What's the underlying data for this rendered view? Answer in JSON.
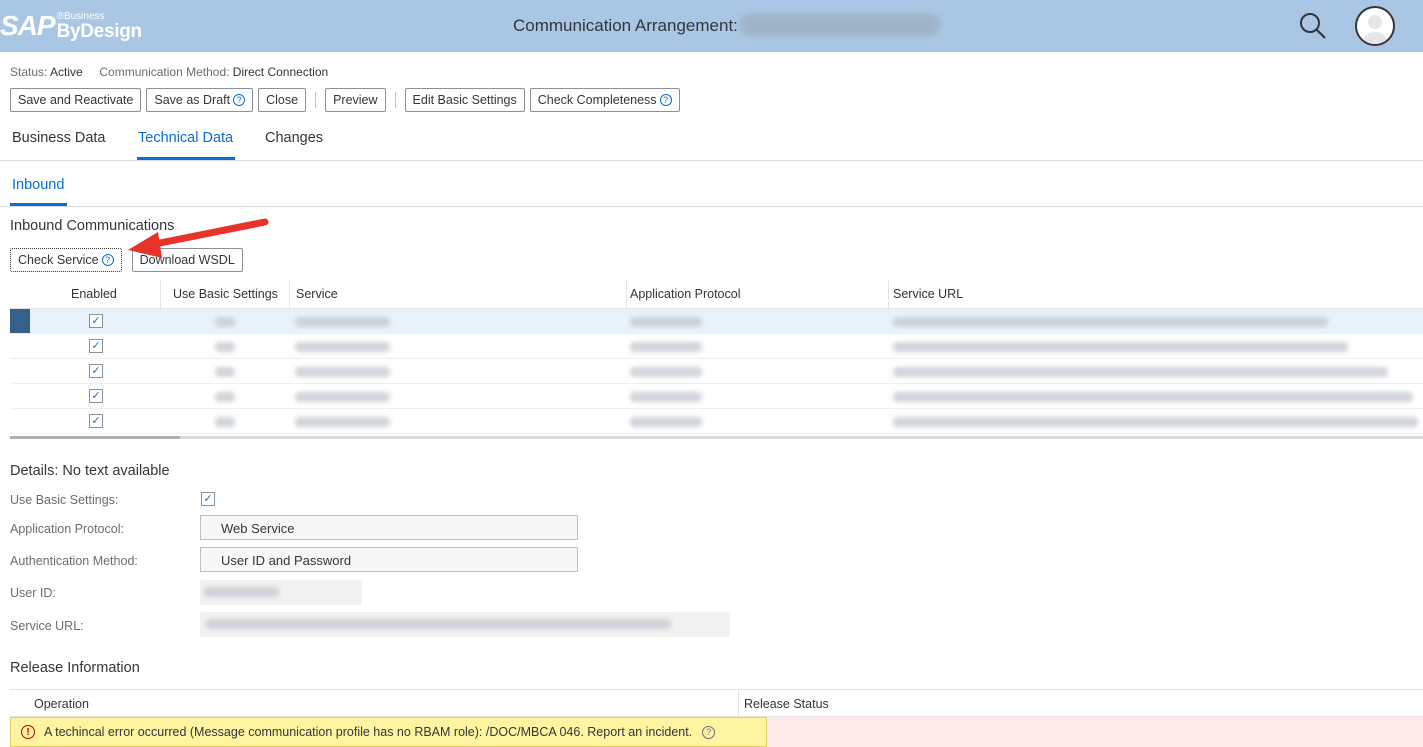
{
  "brand": {
    "sap": "SAP",
    "business": "®Business",
    "bydesign": "ByDesign"
  },
  "header": {
    "title": "Communication Arrangement:"
  },
  "status": {
    "status_label": "Status:",
    "status_value": "Active",
    "method_label": "Communication Method:",
    "method_value": "Direct Connection"
  },
  "toolbar": {
    "save_reactivate": "Save and Reactivate",
    "save_draft": "Save as Draft",
    "close": "Close",
    "preview": "Preview",
    "edit_basic": "Edit Basic Settings",
    "check_completeness": "Check Completeness"
  },
  "tabs": [
    "Business Data",
    "Technical Data",
    "Changes"
  ],
  "subtabs": [
    "Inbound"
  ],
  "inbound": {
    "title": "Inbound Communications",
    "check_service": "Check Service",
    "download_wsdl": "Download WSDL",
    "columns": [
      "Enabled",
      "Use Basic Settings",
      "Service",
      "Application Protocol",
      "Service URL"
    ],
    "rows": [
      {
        "enabled": true
      },
      {
        "enabled": true
      },
      {
        "enabled": true
      },
      {
        "enabled": true
      },
      {
        "enabled": true
      }
    ]
  },
  "details": {
    "title": "Details: No text available",
    "use_basic_label": "Use Basic Settings:",
    "use_basic_checked": true,
    "protocol_label": "Application Protocol:",
    "protocol_value": "Web Service",
    "auth_label": "Authentication Method:",
    "auth_value": "User ID and Password",
    "user_label": "User ID:",
    "url_label": "Service URL:"
  },
  "release": {
    "title": "Release Information",
    "columns": [
      "Operation",
      "Release Status"
    ],
    "error": "A techincal error occurred (Message communication profile has no RBAM role): /DOC/MBCA 046. Report an incident."
  },
  "colors": {
    "shell": "#a9c7e4",
    "accent": "#0a6ed1",
    "error": "#bb0000",
    "highlight": "#fff5a0",
    "annotation_arrow": "#e8332a"
  },
  "icons": {
    "search": "search-icon",
    "avatar": "user-avatar-icon",
    "help": "help-icon",
    "error": "error-icon",
    "check": "check-icon"
  }
}
